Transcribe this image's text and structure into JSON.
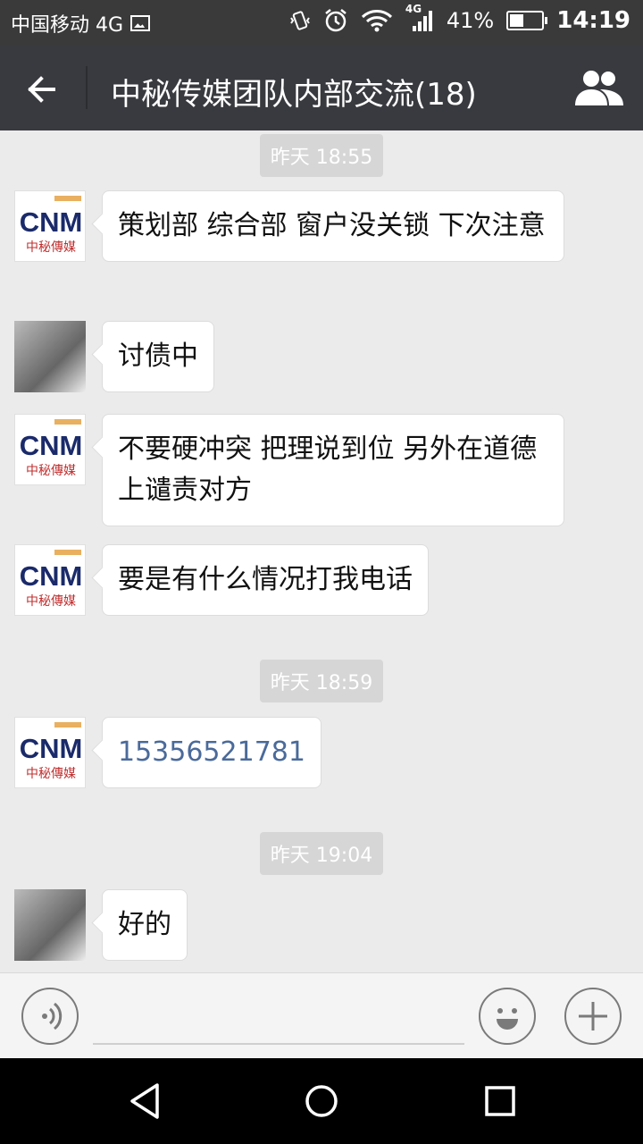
{
  "status_bar": {
    "carrier": "中国移动 4G",
    "battery_percent": "41%",
    "battery_level": 0.41,
    "time": "14:19",
    "net_type": "4G"
  },
  "header": {
    "title": "中秘传媒团队内部交流(18)"
  },
  "avatar_logo": {
    "top_text": "CNM",
    "bottom_text": "中秘傳媒"
  },
  "messages": [
    {
      "type": "time",
      "text": "昨天 18:55"
    },
    {
      "type": "text",
      "sender": "logo",
      "text": "策划部 综合部 窗户没关锁 下次注意"
    },
    {
      "type": "text",
      "sender": "photo",
      "text": "讨债中"
    },
    {
      "type": "text",
      "sender": "logo",
      "text": "不要硬冲突 把理说到位 另外在道德上谴责对方"
    },
    {
      "type": "text",
      "sender": "logo",
      "text": "要是有什么情况打我电话"
    },
    {
      "type": "time",
      "text": "昨天 18:59"
    },
    {
      "type": "link",
      "sender": "logo",
      "text": "15356521781"
    },
    {
      "type": "time",
      "text": "昨天 19:04"
    },
    {
      "type": "text",
      "sender": "photo",
      "text": "好的"
    }
  ],
  "input_bar": {
    "text_value": ""
  }
}
